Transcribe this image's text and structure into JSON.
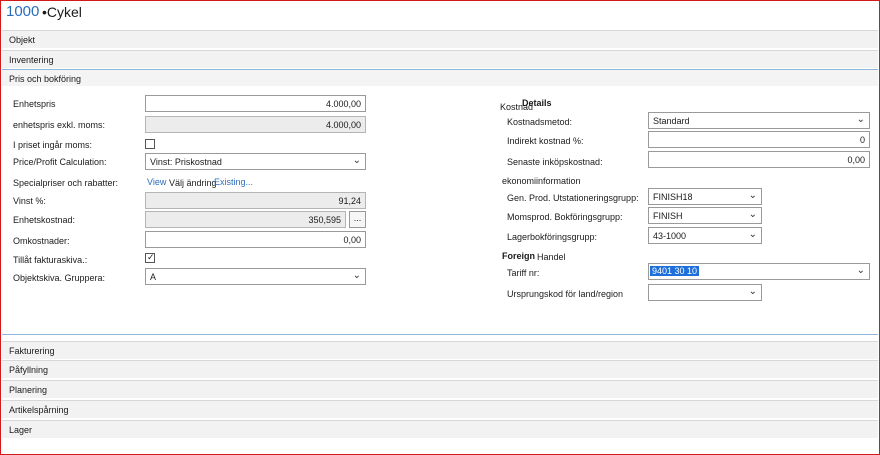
{
  "header": {
    "item_no": "1000",
    "item_name": "•Cykel"
  },
  "tabs_top": {
    "objekt": "Objekt",
    "inventering": "Inventering",
    "pris": "Pris och bokföring"
  },
  "left": {
    "enhetspris_label": "Enhetspris",
    "enhetspris_value": "4.000,00",
    "exkl_label": "enhetspris exkl. moms:",
    "exkl_value": "4.000,00",
    "ingar_label": "I priset ingår moms:",
    "calc_label": "Price/Profit Calculation:",
    "calc_value": "Vinst: Priskostnad",
    "special_label": "Specialpriser och rabatter:",
    "special_view": "View",
    "special_mid": "Välj ändring",
    "special_existing": "Existing...",
    "vinst_label": "Vinst %:",
    "vinst_value": "91,24",
    "enhetskostnad_label": "Enhetskostnad:",
    "enhetskostnad_value": "350,595",
    "ellipsis": "...",
    "omkostnader_label": "Omkostnader:",
    "omkostnader_value": "0,00",
    "tillat_label": "Tillåt fakturaskiva.:",
    "tillat_mark": "✓",
    "objektskiva_label": "Objektskiva. Gruppera:",
    "objektskiva_value": "A"
  },
  "right": {
    "kost_a": "Kostnad",
    "kost_b": "Details",
    "metod_label": "Kostnadsmetod:",
    "metod_value": "Standard",
    "indirekt_label": "Indirekt kostnad %:",
    "indirekt_value": "0",
    "senaste_label": "Senaste inköpskostnad:",
    "senaste_value": "0,00",
    "ekonomi_header": "ekonomiinformation",
    "gen_label": "Gen. Prod. Utstationeringsgrupp:",
    "gen_value": "FINISH18",
    "moms_label": "Momsprod. Bokföringsgrupp:",
    "moms_value": "FINISH",
    "lager_label": "Lagerbokföringsgrupp:",
    "lager_value": "43-1000",
    "foreign_a": "Foreign",
    "foreign_b": "Handel",
    "tariff_label": "Tariff nr:",
    "tariff_value": "9401 30 10",
    "ursprung_label": "Ursprungskod för land/region"
  },
  "tabs_bottom": {
    "fakturering": "Fakturering",
    "pafyllning": "Påfyllning",
    "planering": "Planering",
    "artikel": "Artikelspårning",
    "lager": "Lager"
  },
  "icons": {
    "dropdown": "chevron-down-icon",
    "check": "check-icon"
  }
}
